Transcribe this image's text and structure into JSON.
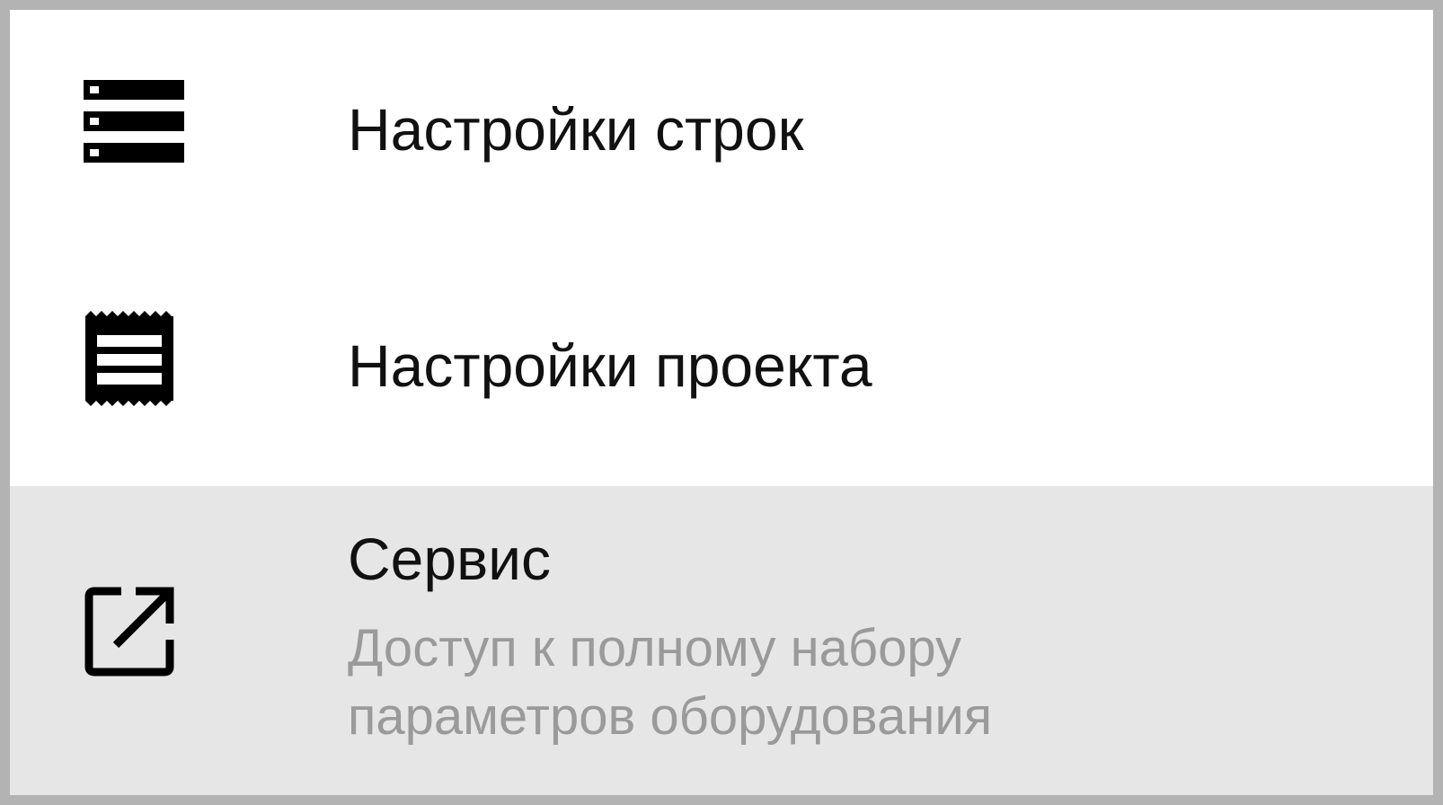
{
  "menu": {
    "items": [
      {
        "label": "Настройки строк",
        "icon": "server-rows-icon"
      },
      {
        "label": "Настройки проекта",
        "icon": "project-document-icon"
      },
      {
        "label": "Сервис",
        "description": "Доступ к полному набору параметров оборудования",
        "icon": "open-external-icon"
      }
    ]
  }
}
